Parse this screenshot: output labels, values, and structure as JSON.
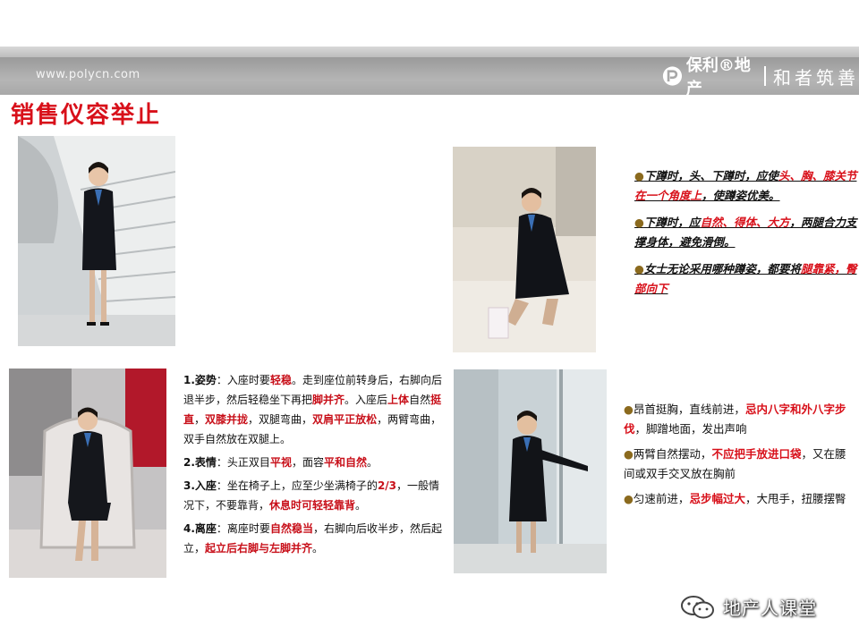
{
  "header": {
    "url": "www.polycn.com",
    "brand_name": "保利®地产",
    "slogan": "和者筑善"
  },
  "page": {
    "title": "销售仪容举止"
  },
  "squat_tips": [
    {
      "parts": [
        {
          "t": "下蹲时，头、下蹲时，应使"
        },
        {
          "t": "头、胸、膝关节在一个角度上",
          "red": true
        },
        {
          "t": "，使蹲姿优美。"
        }
      ]
    },
    {
      "parts": [
        {
          "t": "下蹲时，应"
        },
        {
          "t": "自然、得体、大方",
          "red": true
        },
        {
          "t": "，两腿合力支撑身体，避免滑倒。"
        }
      ]
    },
    {
      "parts": [
        {
          "t": "女士无论采用哪种蹲姿，都要将"
        },
        {
          "t": "腿靠紧，臀部向下",
          "red": true
        }
      ]
    }
  ],
  "sitting_tips": [
    {
      "parts": [
        {
          "t": "1.姿势",
          "b": true
        },
        {
          "t": "：入座时要"
        },
        {
          "t": "轻稳",
          "red": true
        },
        {
          "t": "。走到座位前转身后，右脚向后退半步，然后轻稳坐下再把"
        },
        {
          "t": "脚并齐",
          "red": true
        },
        {
          "t": "。入座后"
        },
        {
          "t": "上体",
          "red": true
        },
        {
          "t": "自然"
        },
        {
          "t": "挺直",
          "red": true
        },
        {
          "t": "，"
        },
        {
          "t": "双膝并拢",
          "red": true
        },
        {
          "t": "，双腿弯曲，"
        },
        {
          "t": "双肩平正放松",
          "red": true
        },
        {
          "t": "，两臂弯曲，双手自然放在双腿上。"
        }
      ]
    },
    {
      "parts": [
        {
          "t": "2.表情",
          "b": true
        },
        {
          "t": "：头正双目"
        },
        {
          "t": "平视",
          "red": true
        },
        {
          "t": "，面容"
        },
        {
          "t": "平和自然",
          "red": true
        },
        {
          "t": "。"
        }
      ]
    },
    {
      "parts": [
        {
          "t": "3.入座",
          "b": true
        },
        {
          "t": "：坐在椅子上，应至少坐满椅子的"
        },
        {
          "t": "2/3",
          "red": true
        },
        {
          "t": "，一般情况下，不要靠背，"
        },
        {
          "t": "休息时可轻轻靠背",
          "red": true
        },
        {
          "t": "。"
        }
      ]
    },
    {
      "parts": [
        {
          "t": "4.离座",
          "b": true
        },
        {
          "t": "：离座时要"
        },
        {
          "t": "自然稳当",
          "red": true
        },
        {
          "t": "，右脚向后收半步，然后起立，"
        },
        {
          "t": "起立后右脚与左脚并齐",
          "red": true
        },
        {
          "t": "。"
        }
      ]
    }
  ],
  "walking_tips": [
    {
      "parts": [
        {
          "t": "昂首挺胸，直线前进，"
        },
        {
          "t": "忌内八字和外八字步伐",
          "red": true
        },
        {
          "t": "，脚蹭地面，发出声响"
        }
      ]
    },
    {
      "parts": [
        {
          "t": "两臂自然摆动，"
        },
        {
          "t": "不应把手放进口袋",
          "red": true
        },
        {
          "t": "，又在腰间或双手交叉放在胸前"
        }
      ]
    },
    {
      "parts": [
        {
          "t": "匀速前进，"
        },
        {
          "t": "忌步幅过大",
          "red": true
        },
        {
          "t": "，大甩手，扭腰摆臀"
        }
      ]
    }
  ],
  "watermark": {
    "text": "地产人课堂"
  },
  "colors": {
    "accent_red": "#d8101a",
    "bullet": "#8b6a1e",
    "header_gray": "#a8a8a8"
  }
}
